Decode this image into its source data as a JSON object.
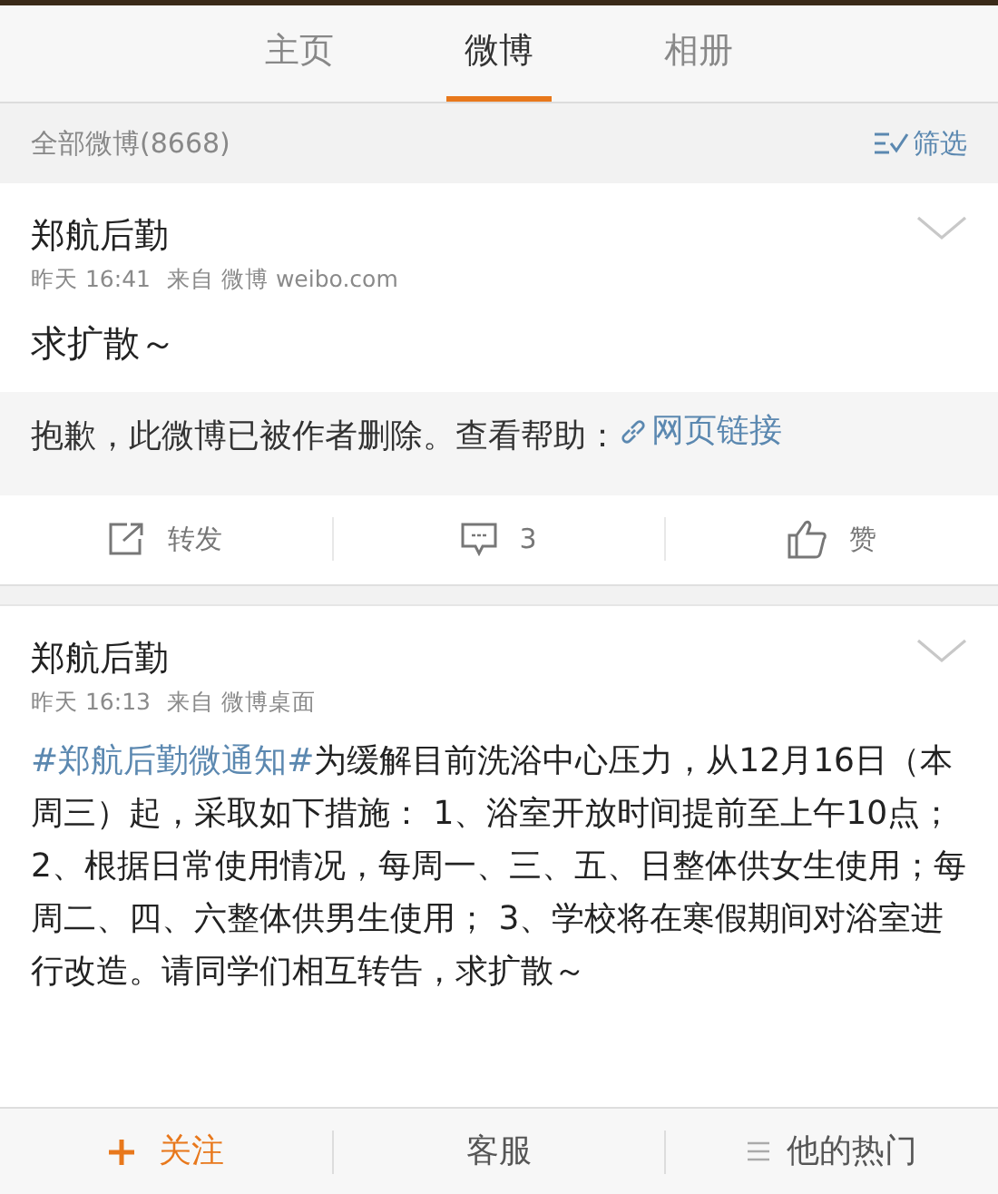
{
  "tabs": [
    {
      "label": "主页",
      "selected": false
    },
    {
      "label": "微博",
      "selected": true
    },
    {
      "label": "相册",
      "selected": false
    }
  ],
  "filter_bar": {
    "count_label": "全部微博(8668)",
    "filter_button": "筛选"
  },
  "posts": [
    {
      "author": "郑航后勤",
      "time": "昨天 16:41",
      "source": "来自 微博 weibo.com",
      "text": "求扩散～",
      "deleted_notice": {
        "text": "抱歉，此微博已被作者删除。查看帮助：",
        "link": "网页链接"
      },
      "actions": {
        "repost": "转发",
        "comments": "3",
        "like": "赞"
      }
    },
    {
      "author": "郑航后勤",
      "time": "昨天 16:13",
      "source": "来自 微博桌面",
      "hashtag": "#郑航后勤微通知#",
      "text": "为缓解目前洗浴中心压力，从12月16日（本周三）起，采取如下措施： 1、浴室开放时间提前至上午10点； 2、根据日常使用情况，每周一、三、五、日整体供女生使用；每周二、四、六整体供男生使用； 3、学校将在寒假期间对浴室进行改造。请同学们相互转告，求扩散～"
    }
  ],
  "bottom_bar": {
    "follow": "关注",
    "service": "客服",
    "hot": "他的热门"
  }
}
